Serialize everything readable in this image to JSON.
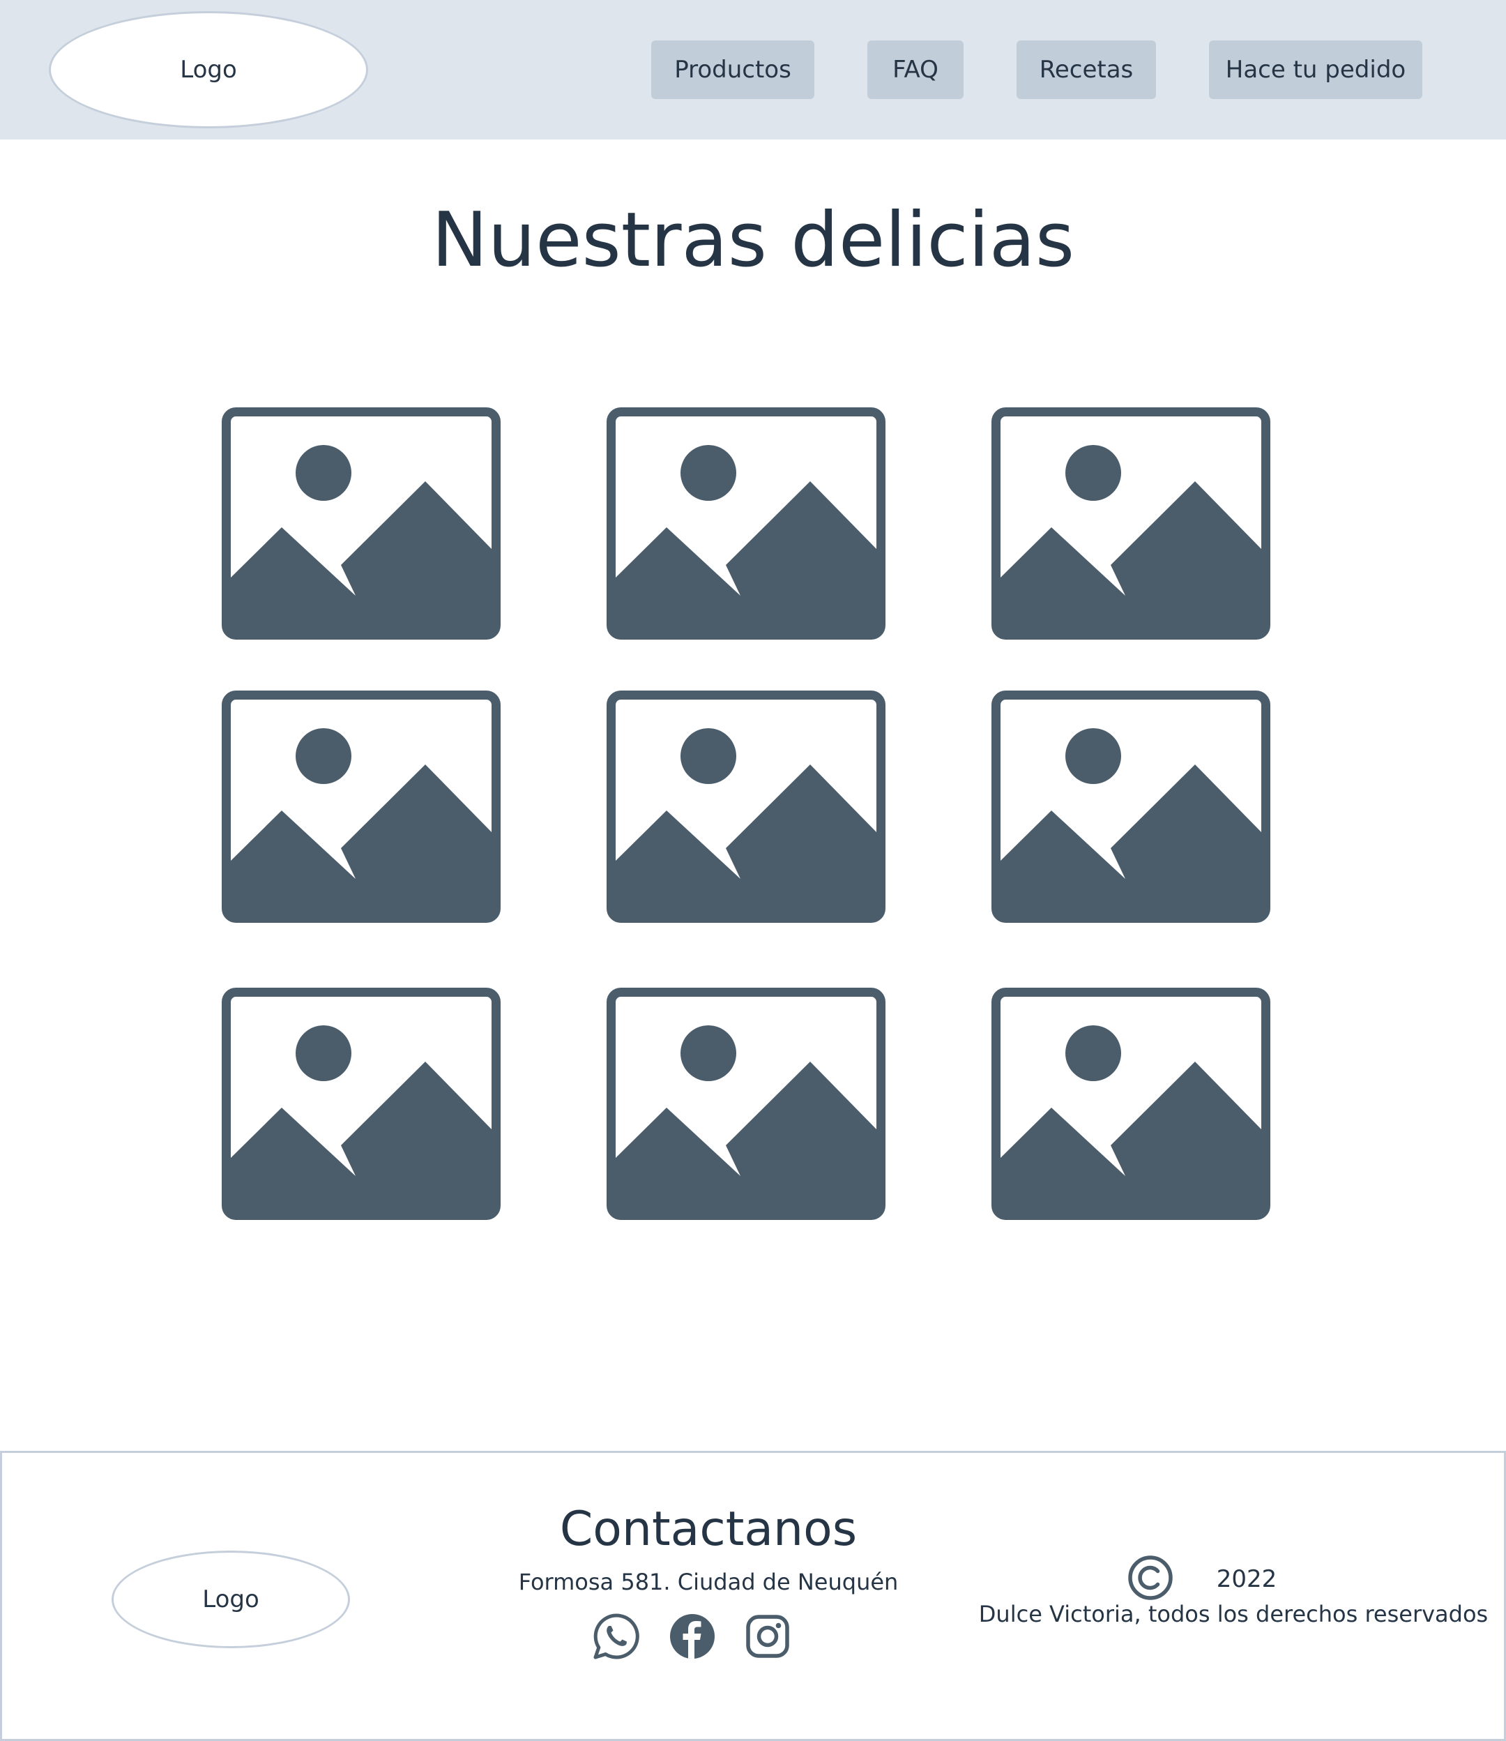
{
  "header": {
    "logo_text": "Logo",
    "nav": [
      {
        "label": "Productos"
      },
      {
        "label": "FAQ"
      },
      {
        "label": "Recetas"
      },
      {
        "label": "Hace tu pedido"
      }
    ]
  },
  "main": {
    "title": "Nuestras delicias",
    "gallery_icon": "image-placeholder-icon",
    "gallery_count": 9
  },
  "footer": {
    "logo_text": "Logo",
    "contact_title": "Contactanos",
    "address": "Formosa 581. Ciudad de Neuquén",
    "social_icons": [
      "whatsapp-icon",
      "facebook-icon",
      "instagram-icon"
    ],
    "copyright_icon": "copyright-icon",
    "year": "2022",
    "rights": "Dulce Victoria, todos los derechos reservados"
  },
  "colors": {
    "header_bg": "#dfe5ed",
    "nav_button_bg": "#c1cdd8",
    "icon": "#4b5c6b",
    "text": "#263545",
    "border": "#c5cfdb"
  }
}
